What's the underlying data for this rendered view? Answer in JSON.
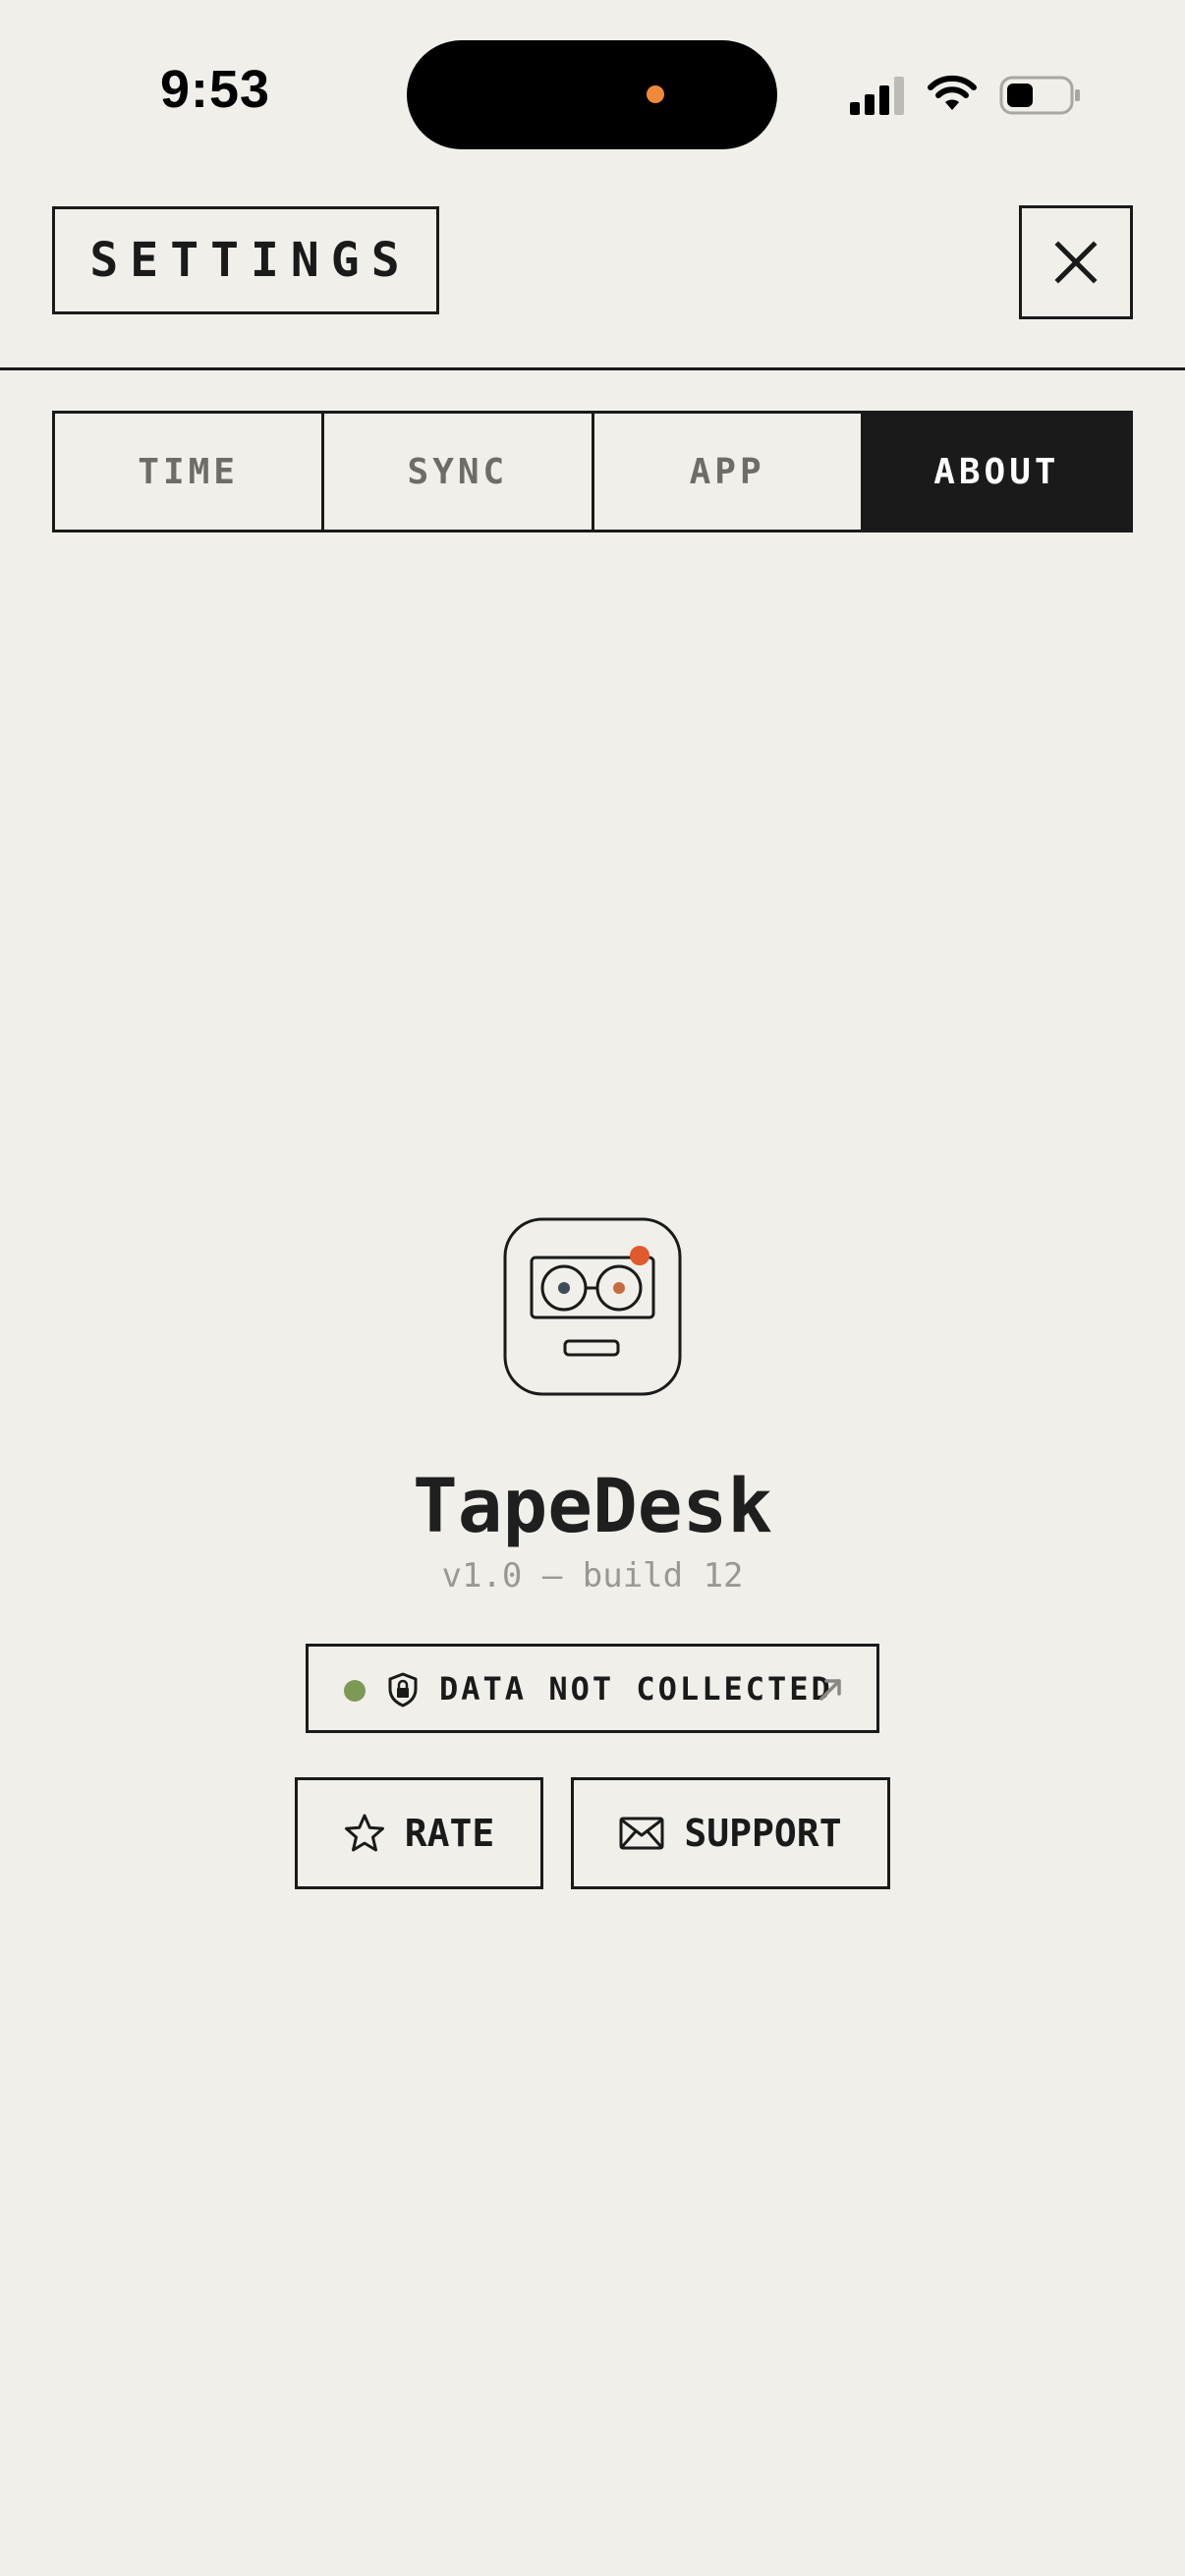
{
  "status_bar": {
    "time": "9:53",
    "icons": [
      "signal-icon",
      "wifi-icon",
      "battery-icon"
    ]
  },
  "header": {
    "title": "SETTINGS",
    "close_icon": "close-icon"
  },
  "tabs": [
    {
      "label": "TIME",
      "active": false
    },
    {
      "label": "SYNC",
      "active": false
    },
    {
      "label": "APP",
      "active": false
    },
    {
      "label": "ABOUT",
      "active": true
    }
  ],
  "about": {
    "app_icon": "robot-glasses-icon",
    "app_name": "TapeDesk",
    "version": "v1.0 — build 12",
    "privacy": {
      "label": "DATA NOT COLLECTED",
      "status_color": "#7c9a56",
      "icons": [
        "shield-lock-icon",
        "external-arrow-icon"
      ]
    },
    "buttons": {
      "rate_label": "RATE",
      "support_label": "SUPPORT"
    }
  },
  "colors": {
    "background": "#f0efea",
    "ink": "#1a1a1a",
    "accent_orange": "#e05a2e",
    "island_dot": "#f08a3b",
    "muted": "#9b9893"
  }
}
